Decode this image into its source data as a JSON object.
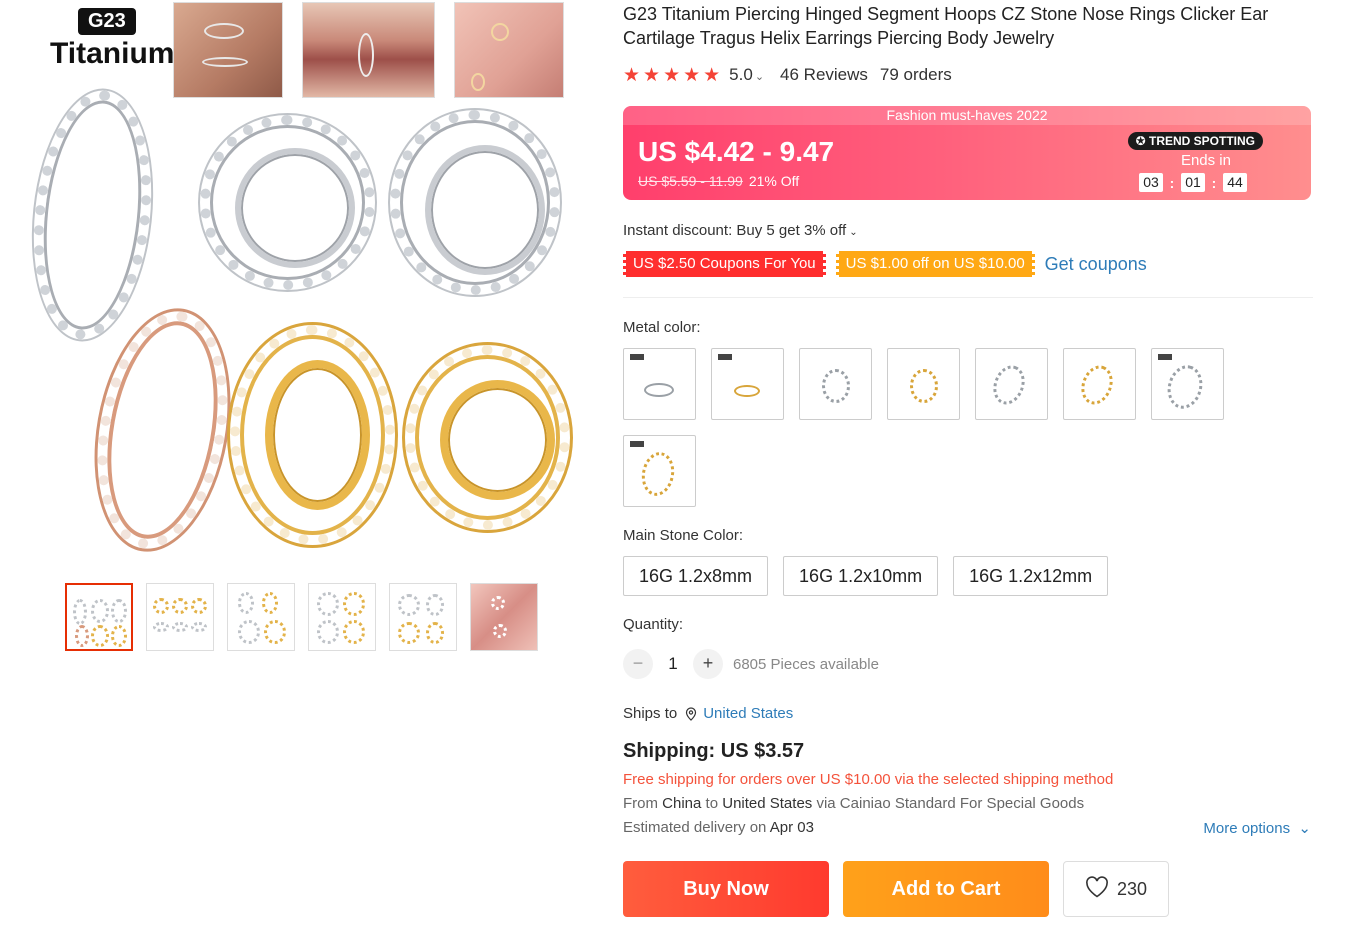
{
  "product": {
    "brand_code": "G23",
    "brand_word": "Titanium",
    "title": "G23 Titanium Piercing Hinged Segment Hoops CZ Stone Nose Rings Clicker Ear Cartilage Tragus Helix Earrings Piercing Body Jewelry",
    "rating": "5.0",
    "stars": "★★★★★",
    "reviews": "46 Reviews",
    "orders": "79 orders"
  },
  "promo": {
    "banner_label": "Fashion must-haves 2022",
    "price_range": "US $4.42 - 9.47",
    "original_price": "US $5.59 - 11.99",
    "discount": "21% Off",
    "trend_badge": "TREND SPOTTING",
    "ends_in": "Ends in",
    "timer": {
      "hours": "03",
      "minutes": "01",
      "seconds": "44"
    },
    "colors": {
      "banner_start": "#ff3f6c",
      "banner_end": "#ff8e8e"
    }
  },
  "discounts": {
    "instant": "Instant discount: Buy 5 get 3% off",
    "coupon_red": "US $2.50 Coupons For You",
    "coupon_orange": "US $1.00 off on US $10.00",
    "get_coupons": "Get coupons"
  },
  "metal_color": {
    "label": "Metal color:",
    "swatches": [
      "silver-thin",
      "gold-thin",
      "silver-triple",
      "gold-triple",
      "silver-double",
      "gold-double",
      "silver-single",
      "gold-single"
    ]
  },
  "stone_color": {
    "label": "Main Stone Color:",
    "options": [
      "16G 1.2x8mm",
      "16G 1.2x10mm",
      "16G 1.2x12mm"
    ]
  },
  "quantity": {
    "label": "Quantity:",
    "minus": "−",
    "plus": "+",
    "value": "1",
    "available": "6805 Pieces available"
  },
  "shipping": {
    "ships_to_label": "Ships to",
    "ships_to_country": "United States",
    "title": "Shipping: US $3.57",
    "free_note": "Free shipping for orders over US $10.00 via the selected shipping method",
    "from_prefix": "From",
    "from_country": "China",
    "to_word": "to",
    "to_country": "United States",
    "via_text": "via Cainiao Standard For Special Goods",
    "delivery_prefix": "Estimated delivery on",
    "delivery_date": "Apr 03",
    "more_options": "More options"
  },
  "actions": {
    "buy_now": "Buy Now",
    "add_to_cart": "Add to Cart",
    "wishlist_count": "230"
  }
}
